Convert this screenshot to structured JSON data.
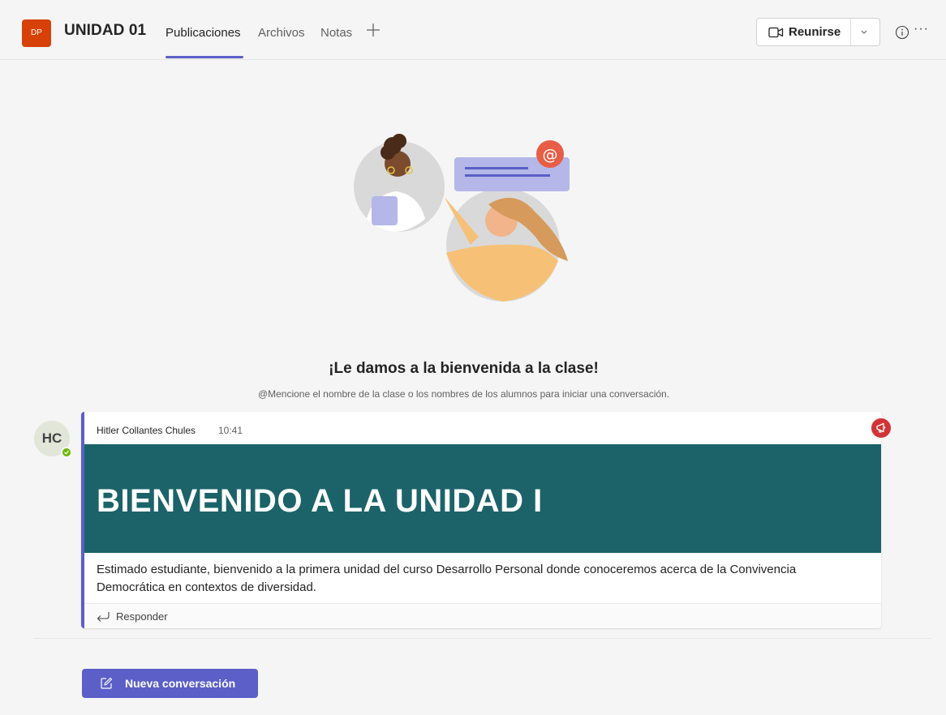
{
  "header": {
    "team_initials": "DP",
    "team_name": "UNIDAD 01",
    "tabs": [
      {
        "label": "Publicaciones",
        "active": true
      },
      {
        "label": "Archivos",
        "active": false
      },
      {
        "label": "Notas",
        "active": false
      }
    ],
    "add_tab_icon": "plus-icon",
    "meet_label": "Reunirse",
    "meet_icon": "video-camera-icon",
    "meet_dropdown_icon": "chevron-down-icon",
    "info_icon": "info-icon",
    "more_label": "···"
  },
  "welcome": {
    "title": "¡Le damos a la bienvenida a la clase!",
    "subtitle": "@Mencione el nombre de la clase o los nombres de los alumnos para iniciar una conversación."
  },
  "post": {
    "avatar_initials": "HC",
    "author": "Hitler Collantes Chules",
    "time": "10:41",
    "banner_title": "BIENVENIDO A LA UNIDAD I",
    "body": "Estimado estudiante, bienvenido a la primera unidad del curso Desarrollo Personal donde conoceremos acerca de la Convivencia Democrática en contextos de diversidad.",
    "reply_label": "Responder"
  },
  "compose": {
    "new_conversation_label": "Nueva conversación"
  },
  "colors": {
    "accent": "#5b5fc7",
    "team_avatar": "#d74108",
    "banner": "#1b6369",
    "announcement": "#d13438",
    "presence_available": "#6bb700"
  }
}
